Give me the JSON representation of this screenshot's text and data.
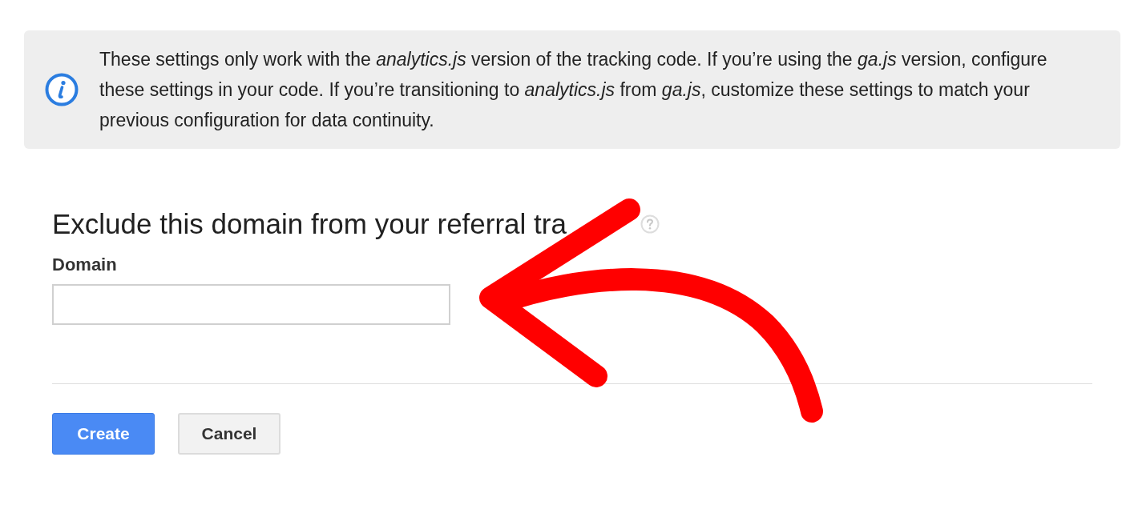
{
  "notice": {
    "text": "These settings only work with the *analytics.js* version of the tracking code. If you’re using the *ga.js* version, configure these settings in your code. If you’re transitioning to *analytics.js* from *ga.js*, customize these settings to match your previous configuration for data continuity."
  },
  "section": {
    "title": "Exclude this domain from your referral tra"
  },
  "field": {
    "label": "Domain"
  },
  "buttons": [
    {
      "label": "Create",
      "kind": "primary"
    },
    {
      "label": "Cancel",
      "kind": "secondary"
    }
  ]
}
